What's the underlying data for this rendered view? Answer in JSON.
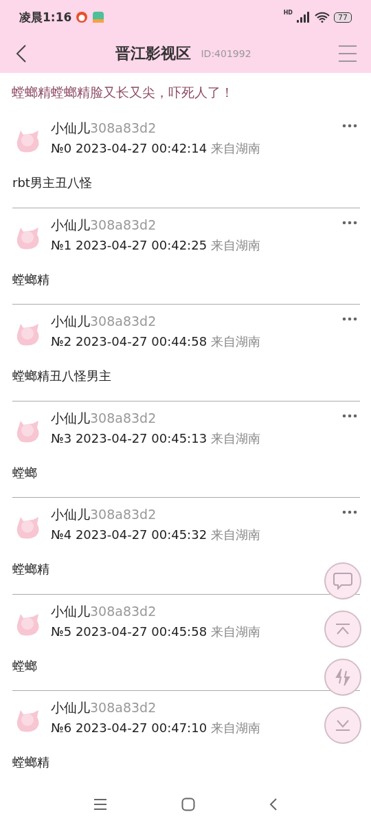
{
  "status_bar": {
    "time": "凌晨1:16",
    "signal_label": "HD",
    "battery": "77"
  },
  "header": {
    "title": "晋江影视区",
    "id": "ID:401992"
  },
  "thread_title": "螳螂精螳螂精脸又长又尖，吓死人了！",
  "posts": [
    {
      "user": "小仙儿",
      "user_id": "308a83d2",
      "floor": "№0",
      "time": "2023-04-27 00:42:14",
      "location": "来自湖南",
      "body": "rbt男主丑八怪"
    },
    {
      "user": "小仙儿",
      "user_id": "308a83d2",
      "floor": "№1",
      "time": "2023-04-27 00:42:25",
      "location": "来自湖南",
      "body": "螳螂精"
    },
    {
      "user": "小仙儿",
      "user_id": "308a83d2",
      "floor": "№2",
      "time": "2023-04-27 00:44:58",
      "location": "来自湖南",
      "body": "螳螂精丑八怪男主"
    },
    {
      "user": "小仙儿",
      "user_id": "308a83d2",
      "floor": "№3",
      "time": "2023-04-27 00:45:13",
      "location": "来自湖南",
      "body": "螳螂"
    },
    {
      "user": "小仙儿",
      "user_id": "308a83d2",
      "floor": "№4",
      "time": "2023-04-27 00:45:32",
      "location": "来自湖南",
      "body": "螳螂精"
    },
    {
      "user": "小仙儿",
      "user_id": "308a83d2",
      "floor": "№5",
      "time": "2023-04-27 00:45:58",
      "location": "来自湖南",
      "body": "螳螂",
      "menu_covered": true
    },
    {
      "user": "小仙儿",
      "user_id": "308a83d2",
      "floor": "№6",
      "time": "2023-04-27 00:47:10",
      "location": "来自湖南",
      "body": "螳螂精",
      "menu_covered": true
    }
  ],
  "floating_buttons": [
    {
      "kind": "reply"
    },
    {
      "kind": "top"
    },
    {
      "kind": "refresh"
    },
    {
      "kind": "bottom"
    }
  ]
}
